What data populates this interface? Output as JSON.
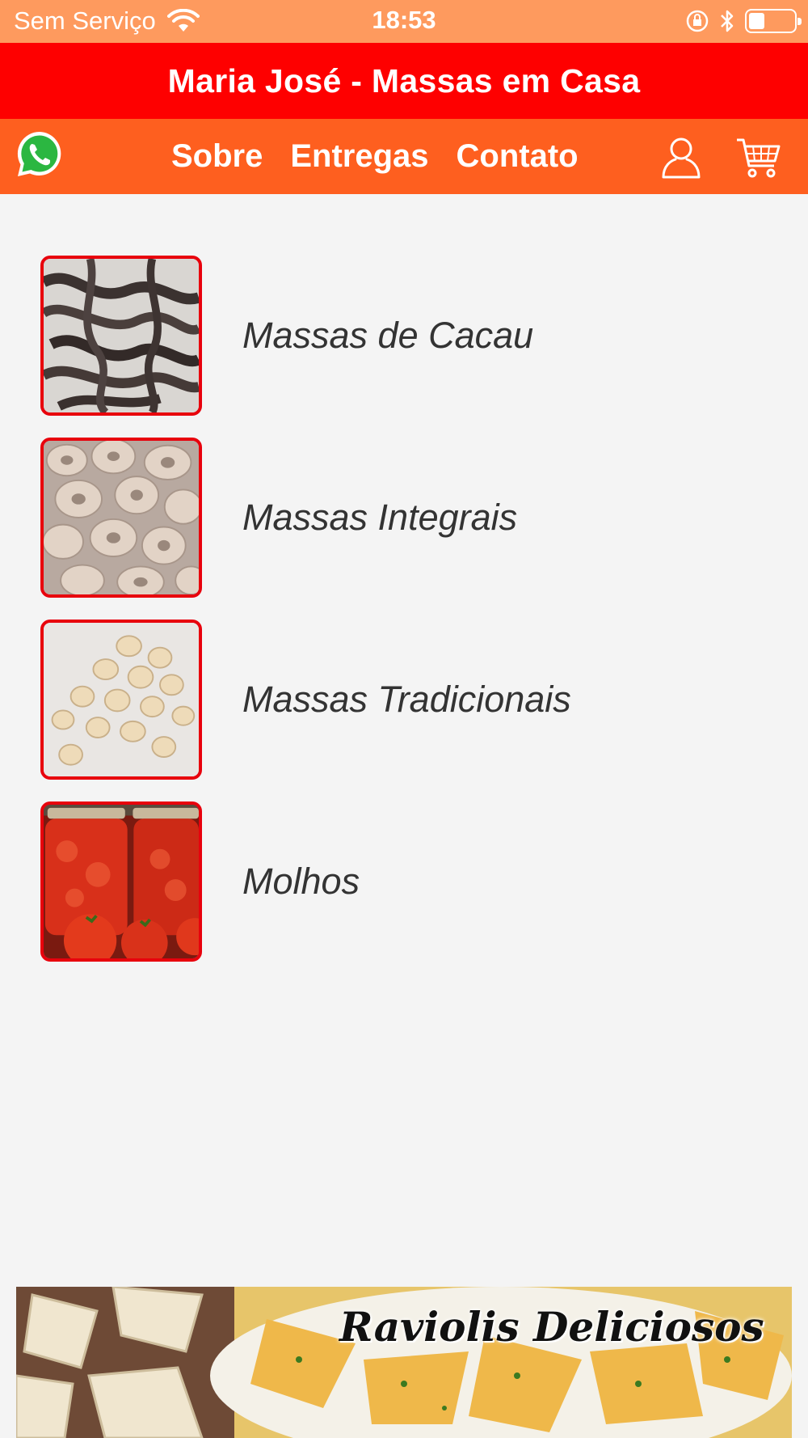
{
  "status_bar": {
    "carrier": "Sem Serviço",
    "time": "18:53",
    "battery_level": 0.35
  },
  "header": {
    "title": "Maria José - Massas em Casa"
  },
  "nav": {
    "links": [
      {
        "label": "Sobre"
      },
      {
        "label": "Entregas"
      },
      {
        "label": "Contato"
      }
    ],
    "icons": [
      "whatsapp-icon",
      "user-icon",
      "cart-icon"
    ]
  },
  "categories": [
    {
      "label": "Massas de Cacau",
      "image": "dark cocoa fettuccine"
    },
    {
      "label": "Massas Integrais",
      "image": "whole wheat tortellini"
    },
    {
      "label": "Massas Tradicionais",
      "image": "traditional tortellini"
    },
    {
      "label": "Molhos",
      "image": "tomato sauce jars"
    }
  ],
  "banner": {
    "text": "Raviolis Deliciosos"
  },
  "colors": {
    "status_bar": "#fe9a5e",
    "title_bar": "#fe0000",
    "nav_bar": "#fe5f1f",
    "thumb_border": "#e8000c",
    "background": "#f4f4f4"
  }
}
